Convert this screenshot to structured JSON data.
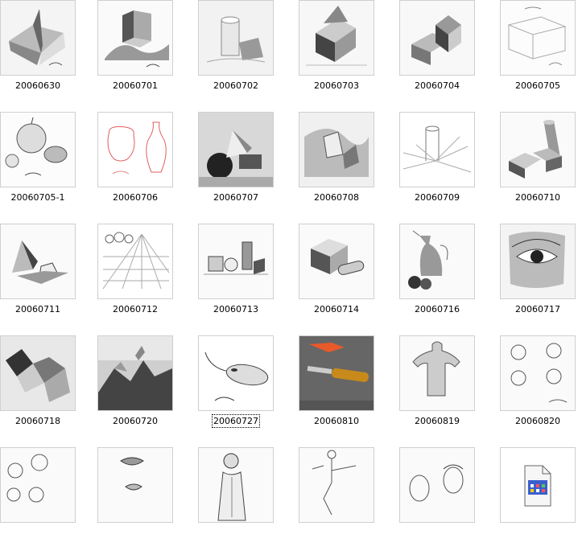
{
  "items": [
    {
      "label": "20060630",
      "art": "cube-cross"
    },
    {
      "label": "20060701",
      "art": "cube-cloth"
    },
    {
      "label": "20060702",
      "art": "cylinder"
    },
    {
      "label": "20060703",
      "art": "house-block"
    },
    {
      "label": "20060704",
      "art": "house-block-2"
    },
    {
      "label": "20060705",
      "art": "sketch-box"
    },
    {
      "label": "20060705-1",
      "art": "apple"
    },
    {
      "label": "20060706",
      "art": "vases-red"
    },
    {
      "label": "20060707",
      "art": "sphere-pyramid"
    },
    {
      "label": "20060708",
      "art": "still-life"
    },
    {
      "label": "20060709",
      "art": "cylinder-lines"
    },
    {
      "label": "20060710",
      "art": "cylinder-boxes"
    },
    {
      "label": "20060711",
      "art": "pyramid-hex"
    },
    {
      "label": "20060712",
      "art": "perspective"
    },
    {
      "label": "20060713",
      "art": "objects-row"
    },
    {
      "label": "20060714",
      "art": "cube-cyl"
    },
    {
      "label": "20060716",
      "art": "jug"
    },
    {
      "label": "20060717",
      "art": "eye"
    },
    {
      "label": "20060718",
      "art": "rocks"
    },
    {
      "label": "20060720",
      "art": "mountain"
    },
    {
      "label": "20060727",
      "art": "mouse",
      "selected": true
    },
    {
      "label": "20060810",
      "art": "knife-carrot"
    },
    {
      "label": "20060819",
      "art": "torso"
    },
    {
      "label": "20060820",
      "art": "heads"
    },
    {
      "label": "",
      "art": "faces"
    },
    {
      "label": "",
      "art": "lips"
    },
    {
      "label": "",
      "art": "figure"
    },
    {
      "label": "",
      "art": "mannequin"
    },
    {
      "label": "",
      "art": "portraits"
    },
    {
      "label": "",
      "art": "file-icon"
    }
  ]
}
